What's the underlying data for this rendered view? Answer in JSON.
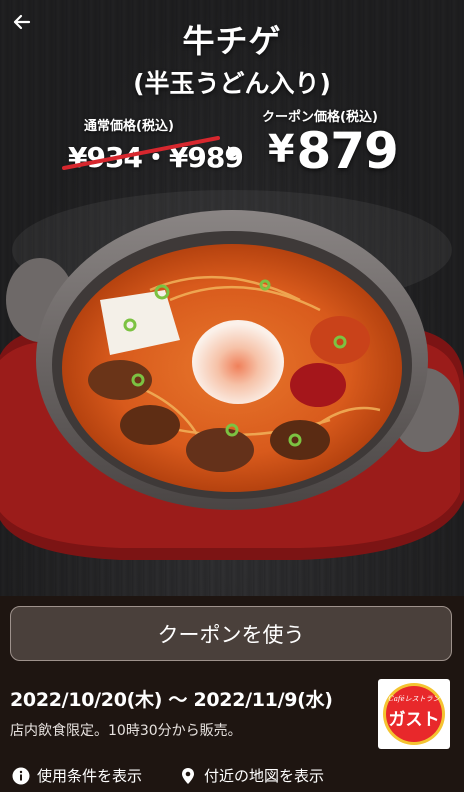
{
  "header": {
    "back_icon": "back-arrow-icon"
  },
  "product": {
    "name": "牛チゲ",
    "subname": "(半玉うどん入り)"
  },
  "pricing": {
    "regular_label": "通常価格(税込)",
    "regular_price": "¥934・¥989",
    "coupon_label": "クーポン価格(税込)",
    "coupon_yen": "¥",
    "coupon_amount": "879",
    "strike_color": "#d7272e"
  },
  "action": {
    "use_coupon_label": "クーポンを使う"
  },
  "validity": {
    "period": "2022/10/20(木) 〜 2022/11/9(水)",
    "note": "店内飲食限定。10時30分から販売。"
  },
  "brand": {
    "script": "Caféレストラン",
    "name": "ガスト",
    "circle_color": "#e8282b",
    "ring_color": "#f4c431"
  },
  "footer": {
    "terms_label": "使用条件を表示",
    "terms_icon": "info-icon",
    "map_label": "付近の地図を表示",
    "map_icon": "location-pin-icon"
  }
}
